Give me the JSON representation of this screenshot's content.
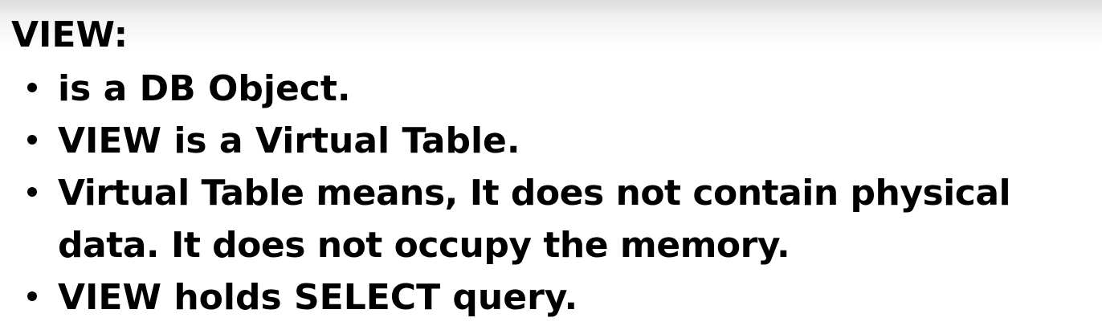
{
  "slide": {
    "heading": "VIEW:",
    "bullets": [
      {
        "lines": [
          "is a DB Object."
        ]
      },
      {
        "lines": [
          "VIEW is a Virtual Table."
        ]
      },
      {
        "lines": [
          "Virtual Table means, It does not contain physical",
          "data. It does not occupy the memory."
        ]
      },
      {
        "lines": [
          "VIEW holds SELECT query."
        ]
      }
    ]
  },
  "colors": {
    "text": "#000000",
    "background": "#ffffff",
    "top_shade": "#dcdcdc"
  }
}
